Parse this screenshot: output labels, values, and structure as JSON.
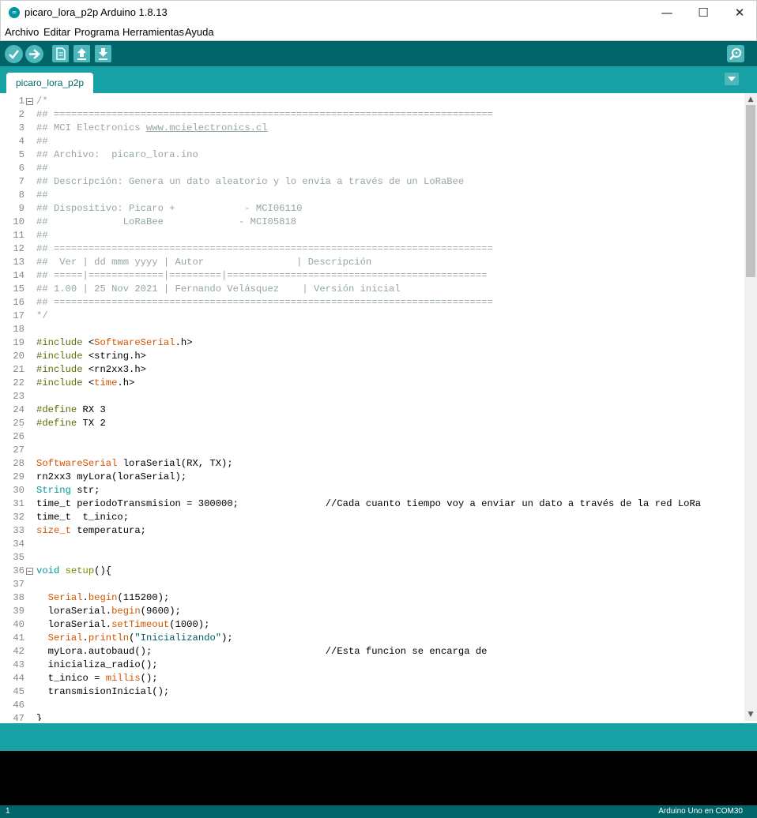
{
  "window": {
    "title": "picaro_lora_p2p Arduino 1.8.13",
    "app_icon": "arduino-logo-icon",
    "controls": {
      "minimize": "—",
      "maximize": "☐",
      "close": "✕"
    }
  },
  "menu": [
    "Archivo",
    "Editar",
    "Programa",
    "Herramientas",
    "Ayuda"
  ],
  "toolbar": {
    "buttons": [
      "verify-icon",
      "upload-icon",
      "new-icon",
      "open-icon",
      "save-icon"
    ],
    "serial_monitor": "serial-monitor-icon"
  },
  "tab": {
    "label": "picaro_lora_p2p",
    "menu_icon": "tab-menu-dropdown-icon"
  },
  "colors": {
    "toolbar": "#006468",
    "tabbar": "#17a1a5",
    "button": "#4db7bb",
    "comment": "#95a5a6",
    "preprocessor": "#5e6d03",
    "type": "#00979c",
    "function": "#d35400",
    "keyword": "#728e00",
    "string": "#005c5f"
  },
  "code_lines": [
    {
      "n": "1",
      "fold": true,
      "segs": [
        {
          "t": "/*",
          "c": "comment"
        }
      ]
    },
    {
      "n": "2",
      "segs": [
        {
          "t": "## ============================================================================",
          "c": "comment"
        }
      ]
    },
    {
      "n": "3",
      "segs": [
        {
          "t": "## MCI Electronics ",
          "c": "comment"
        },
        {
          "t": "www.mcielectronics.cl",
          "c": "link"
        }
      ]
    },
    {
      "n": "4",
      "segs": [
        {
          "t": "##",
          "c": "comment"
        }
      ]
    },
    {
      "n": "5",
      "segs": [
        {
          "t": "## Archivo:  picaro_lora.ino",
          "c": "comment"
        }
      ]
    },
    {
      "n": "6",
      "segs": [
        {
          "t": "##",
          "c": "comment"
        }
      ]
    },
    {
      "n": "7",
      "segs": [
        {
          "t": "## Descripción: Genera un dato aleatorio y lo envia a través de un LoRaBee",
          "c": "comment"
        }
      ]
    },
    {
      "n": "8",
      "segs": [
        {
          "t": "##",
          "c": "comment"
        }
      ]
    },
    {
      "n": "9",
      "segs": [
        {
          "t": "## Dispositivo: Picaro +            - MCI06110",
          "c": "comment"
        }
      ]
    },
    {
      "n": "10",
      "segs": [
        {
          "t": "##             LoRaBee             - MCI05818",
          "c": "comment"
        }
      ]
    },
    {
      "n": "11",
      "segs": [
        {
          "t": "##",
          "c": "comment"
        }
      ]
    },
    {
      "n": "12",
      "segs": [
        {
          "t": "## ============================================================================",
          "c": "comment"
        }
      ]
    },
    {
      "n": "13",
      "segs": [
        {
          "t": "##  Ver | dd mmm yyyy | Autor                | Descripción",
          "c": "comment"
        }
      ]
    },
    {
      "n": "14",
      "segs": [
        {
          "t": "## =====|=============|=========|=============================================",
          "c": "comment"
        }
      ]
    },
    {
      "n": "15",
      "segs": [
        {
          "t": "## 1.00 | 25 Nov 2021 | Fernando Velásquez    | Versión inicial",
          "c": "comment"
        }
      ]
    },
    {
      "n": "16",
      "segs": [
        {
          "t": "## ============================================================================",
          "c": "comment"
        }
      ]
    },
    {
      "n": "17",
      "segs": [
        {
          "t": "*/",
          "c": "comment"
        }
      ]
    },
    {
      "n": "18",
      "segs": []
    },
    {
      "n": "19",
      "segs": [
        {
          "t": "#include",
          "c": "pre"
        },
        {
          "t": " <",
          "c": "plain"
        },
        {
          "t": "SoftwareSerial",
          "c": "func"
        },
        {
          "t": ".h>",
          "c": "plain"
        }
      ]
    },
    {
      "n": "20",
      "segs": [
        {
          "t": "#include",
          "c": "pre"
        },
        {
          "t": " <string.h>",
          "c": "plain"
        }
      ]
    },
    {
      "n": "21",
      "segs": [
        {
          "t": "#include",
          "c": "pre"
        },
        {
          "t": " <rn2xx3.h>",
          "c": "plain"
        }
      ]
    },
    {
      "n": "22",
      "segs": [
        {
          "t": "#include",
          "c": "pre"
        },
        {
          "t": " <",
          "c": "plain"
        },
        {
          "t": "time",
          "c": "func"
        },
        {
          "t": ".h>",
          "c": "plain"
        }
      ]
    },
    {
      "n": "23",
      "segs": []
    },
    {
      "n": "24",
      "segs": [
        {
          "t": "#define",
          "c": "pre"
        },
        {
          "t": " RX 3",
          "c": "plain"
        }
      ]
    },
    {
      "n": "25",
      "segs": [
        {
          "t": "#define",
          "c": "pre"
        },
        {
          "t": " TX 2",
          "c": "plain"
        }
      ]
    },
    {
      "n": "26",
      "segs": []
    },
    {
      "n": "27",
      "segs": []
    },
    {
      "n": "28",
      "segs": [
        {
          "t": "SoftwareSerial",
          "c": "func"
        },
        {
          "t": " loraSerial(RX, TX);",
          "c": "plain"
        }
      ]
    },
    {
      "n": "29",
      "segs": [
        {
          "t": "rn2xx3 myLora(loraSerial);",
          "c": "plain"
        }
      ]
    },
    {
      "n": "30",
      "segs": [
        {
          "t": "String",
          "c": "type"
        },
        {
          "t": " str;",
          "c": "plain"
        }
      ]
    },
    {
      "n": "31",
      "segs": [
        {
          "t": "time_t periodoTransmision = 300000;",
          "c": "plain"
        },
        {
          "t": "               //Cada cuanto tiempo voy a enviar un dato a través de la red LoRa",
          "c": "plain"
        }
      ]
    },
    {
      "n": "32",
      "segs": [
        {
          "t": "time_t  t_inico;",
          "c": "plain"
        }
      ]
    },
    {
      "n": "33",
      "segs": [
        {
          "t": "size_t",
          "c": "func"
        },
        {
          "t": " temperatura;",
          "c": "plain"
        }
      ]
    },
    {
      "n": "34",
      "segs": []
    },
    {
      "n": "35",
      "segs": []
    },
    {
      "n": "36",
      "fold": true,
      "segs": [
        {
          "t": "void",
          "c": "type"
        },
        {
          "t": " ",
          "c": "plain"
        },
        {
          "t": "setup",
          "c": "kw"
        },
        {
          "t": "(){",
          "c": "plain"
        }
      ]
    },
    {
      "n": "37",
      "segs": []
    },
    {
      "n": "38",
      "segs": [
        {
          "t": "  ",
          "c": "plain"
        },
        {
          "t": "Serial",
          "c": "func"
        },
        {
          "t": ".",
          "c": "plain"
        },
        {
          "t": "begin",
          "c": "func"
        },
        {
          "t": "(115200);",
          "c": "plain"
        }
      ]
    },
    {
      "n": "39",
      "segs": [
        {
          "t": "  loraSerial.",
          "c": "plain"
        },
        {
          "t": "begin",
          "c": "func"
        },
        {
          "t": "(9600);",
          "c": "plain"
        }
      ]
    },
    {
      "n": "40",
      "segs": [
        {
          "t": "  loraSerial.",
          "c": "plain"
        },
        {
          "t": "setTimeout",
          "c": "func"
        },
        {
          "t": "(1000);",
          "c": "plain"
        }
      ]
    },
    {
      "n": "41",
      "segs": [
        {
          "t": "  ",
          "c": "plain"
        },
        {
          "t": "Serial",
          "c": "func"
        },
        {
          "t": ".",
          "c": "plain"
        },
        {
          "t": "println",
          "c": "func"
        },
        {
          "t": "(",
          "c": "plain"
        },
        {
          "t": "\"Inicializando\"",
          "c": "str"
        },
        {
          "t": ");",
          "c": "plain"
        }
      ]
    },
    {
      "n": "42",
      "segs": [
        {
          "t": "  myLora.autobaud();",
          "c": "plain"
        },
        {
          "t": "                              //Esta funcion se encarga de",
          "c": "plain"
        }
      ]
    },
    {
      "n": "43",
      "segs": [
        {
          "t": "  inicializa_radio();",
          "c": "plain"
        }
      ]
    },
    {
      "n": "44",
      "segs": [
        {
          "t": "  t_inico = ",
          "c": "plain"
        },
        {
          "t": "millis",
          "c": "func"
        },
        {
          "t": "();",
          "c": "plain"
        }
      ]
    },
    {
      "n": "45",
      "segs": [
        {
          "t": "  transmisionInicial();",
          "c": "plain"
        }
      ]
    },
    {
      "n": "46",
      "segs": []
    },
    {
      "n": "47",
      "segs": [
        {
          "t": "}",
          "c": "plain"
        }
      ]
    }
  ],
  "status": {
    "line": "1",
    "board": "Arduino Uno en COM30"
  }
}
